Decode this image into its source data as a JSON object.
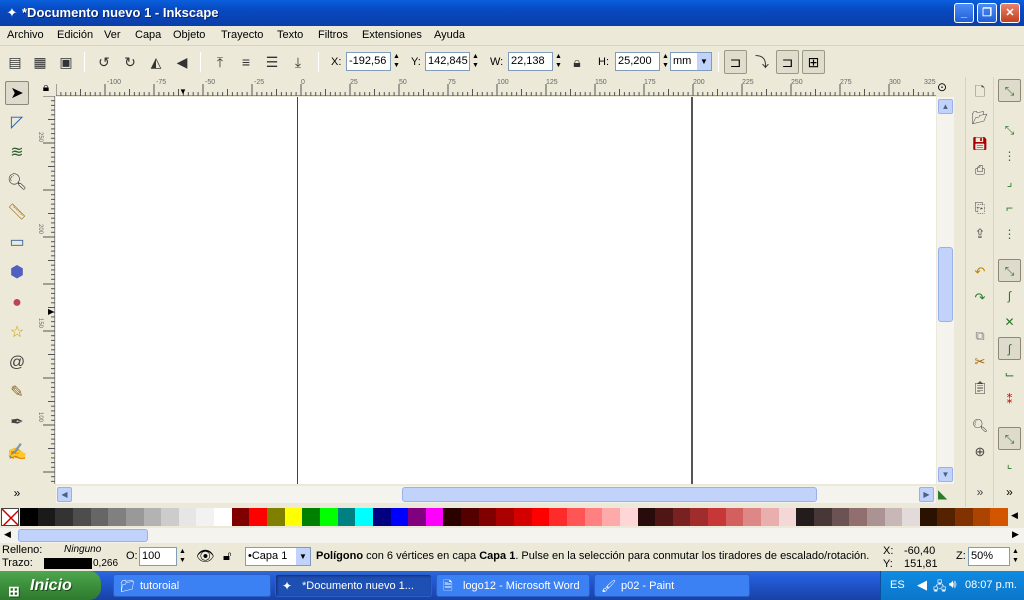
{
  "window": {
    "title": "*Documento nuevo 1 - Inkscape",
    "minimize": "_",
    "maximize": "❐",
    "close": "✕"
  },
  "menu": [
    "Archivo",
    "Edición",
    "Ver",
    "Capa",
    "Objeto",
    "Trayecto",
    "Texto",
    "Filtros",
    "Extensiones",
    "Ayuda"
  ],
  "toolbar": {
    "x_label": "X:",
    "x_value": "-192,56",
    "y_label": "Y:",
    "y_value": "142,845",
    "w_label": "W:",
    "w_value": "22,138",
    "h_label": "H:",
    "h_value": "25,200",
    "unit": "mm"
  },
  "ruler": {
    "h_ticks": [
      "-100",
      "-75",
      "-50",
      "-25",
      "0",
      "25",
      "50",
      "75",
      "100",
      "125",
      "150",
      "175",
      "200",
      "225",
      "250",
      "275",
      "300",
      "325"
    ],
    "v_ticks": [
      "250",
      "200",
      "150",
      "100"
    ]
  },
  "tools": [
    "selector",
    "node",
    "tweak",
    "zoom",
    "measure",
    "rect",
    "box3d",
    "ellipse",
    "star",
    "spiral",
    "pencil",
    "pen",
    "calligraphy"
  ],
  "palette": {
    "colors": [
      "#000000",
      "#1a1a1a",
      "#333333",
      "#4d4d4d",
      "#666666",
      "#808080",
      "#999999",
      "#b3b3b3",
      "#cccccc",
      "#e6e6e6",
      "#f2f2f2",
      "#ffffff",
      "#800000",
      "#ff0000",
      "#808000",
      "#ffff00",
      "#008000",
      "#00ff00",
      "#008080",
      "#00ffff",
      "#000080",
      "#0000ff",
      "#800080",
      "#ff00ff",
      "#2b0000",
      "#550000",
      "#800000",
      "#aa0000",
      "#d40000",
      "#ff0000",
      "#ff2a2a",
      "#ff5555",
      "#ff8080",
      "#ffaaaa",
      "#ffd5d5",
      "#280b0b",
      "#501616",
      "#782121",
      "#a02c2c",
      "#c83737",
      "#d35f5f",
      "#de8787",
      "#e9afaf",
      "#f4d7d7",
      "#241c1c",
      "#483737",
      "#6c5353",
      "#916f6f",
      "#ac9393",
      "#c8b7b7",
      "#e3dbdb",
      "#2b1100",
      "#552200",
      "#803300",
      "#aa4400",
      "#d45500"
    ]
  },
  "status": {
    "fill_label": "Relleno:",
    "fill_value": "Ninguno",
    "stroke_label": "Trazo:",
    "stroke_width": "0,266",
    "opacity_label": "O:",
    "opacity_value": "100",
    "layer": "•Capa 1",
    "message_bold": "Polígono",
    "message_mid": " con 6 vértices en capa ",
    "message_layer": "Capa 1",
    "message_rest": ". Pulse en la selección para conmutar los tiradores de escalado/rotación.",
    "cursor_x_label": "X:",
    "cursor_x": "-60,40",
    "cursor_y_label": "Y:",
    "cursor_y": "151,81",
    "zoom_label": "Z:",
    "zoom_value": "50%"
  },
  "taskbar": {
    "start": "Inicio",
    "tasks": [
      "tutoroial",
      "*Documento nuevo 1...",
      "logo12 - Microsoft Word",
      "p02 - Paint"
    ],
    "lang": "ES",
    "clock": "08:07 p.m."
  }
}
